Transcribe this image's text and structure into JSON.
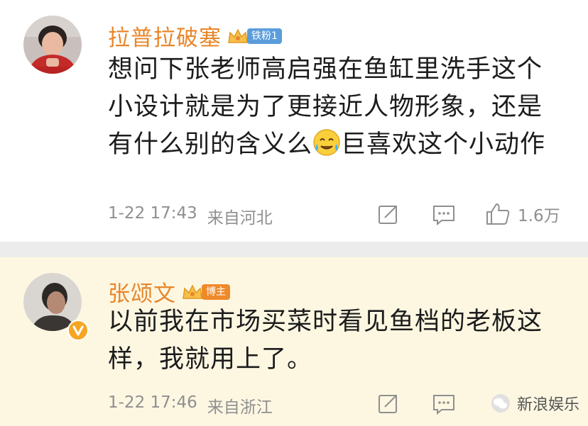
{
  "comments": [
    {
      "user": "拉普拉破塞",
      "badge": "铁粉1",
      "text_before_emoji": "想问下张老师高启强在鱼缸里洗手这个小设计就是为了更接近人物形象，还是有什么别的含义么",
      "emoji": "tear-smile-emoji",
      "text_after_emoji": "巨喜欢这个小动作",
      "time": "1-22 17:43",
      "location": "来自河北",
      "likes": "1.6万"
    },
    {
      "user": "张颂文",
      "badge": "博主",
      "text": "以前我在市场买菜时看见鱼档的老板这样，我就用上了。",
      "time": "1-22 17:46",
      "location": "来自浙江"
    }
  ],
  "watermark": "新浪娱乐",
  "colors": {
    "name": "#e8862a",
    "fan_badge": "#5b9ddc",
    "host_badge": "#ef8a2c",
    "highlight_bg": "#fdf7e2"
  }
}
